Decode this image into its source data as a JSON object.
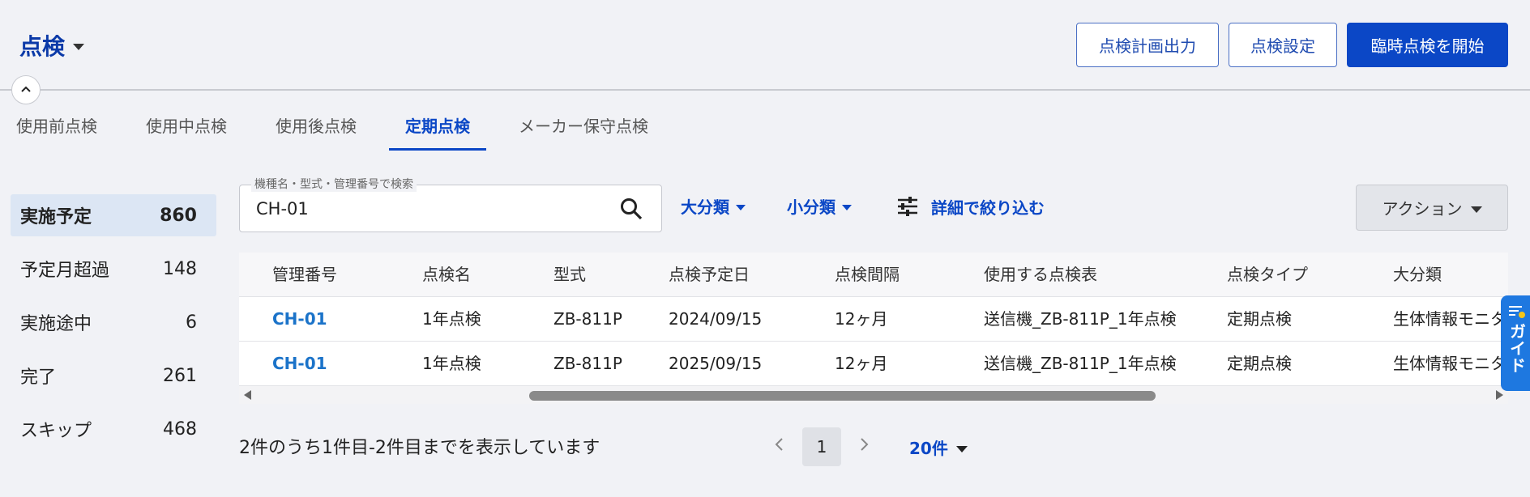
{
  "header": {
    "title": "点検",
    "buttons": {
      "plan_output": "点検計画出力",
      "settings": "点検設定",
      "start_adhoc": "臨時点検を開始"
    }
  },
  "tabs": [
    {
      "label": "使用前点検",
      "active": false
    },
    {
      "label": "使用中点検",
      "active": false
    },
    {
      "label": "使用後点検",
      "active": false
    },
    {
      "label": "定期点検",
      "active": true
    },
    {
      "label": "メーカー保守点検",
      "active": false
    }
  ],
  "status_list": [
    {
      "label": "実施予定",
      "count": "860",
      "active": true
    },
    {
      "label": "予定月超過",
      "count": "148",
      "active": false
    },
    {
      "label": "実施途中",
      "count": "6",
      "active": false
    },
    {
      "label": "完了",
      "count": "261",
      "active": false
    },
    {
      "label": "スキップ",
      "count": "468",
      "active": false
    }
  ],
  "search": {
    "label": "機種名・型式・管理番号で検索",
    "value": "CH-01"
  },
  "filters": {
    "major": "大分類",
    "minor": "小分類",
    "detail": "詳細で絞り込む"
  },
  "action_label": "アクション",
  "table": {
    "headers": [
      "管理番号",
      "点検名",
      "型式",
      "点検予定日",
      "点検間隔",
      "使用する点検表",
      "点検タイプ",
      "大分類"
    ],
    "rows": [
      [
        "CH-01",
        "1年点検",
        "ZB-811P",
        "2024/09/15",
        "12ヶ月",
        "送信機_ZB-811P_1年点検",
        "定期点検",
        "生体情報モニタ"
      ],
      [
        "CH-01",
        "1年点検",
        "ZB-811P",
        "2025/09/15",
        "12ヶ月",
        "送信機_ZB-811P_1年点検",
        "定期点検",
        "生体情報モニタ"
      ]
    ]
  },
  "guide_label": "ガイド",
  "paging": {
    "info": "2件のうち1件目-2件目までを表示しています",
    "current_page": "1",
    "per_page": "20件"
  },
  "colors": {
    "primary": "#0b47c6",
    "link": "#1b73c9",
    "background": "#f1f2f6"
  }
}
